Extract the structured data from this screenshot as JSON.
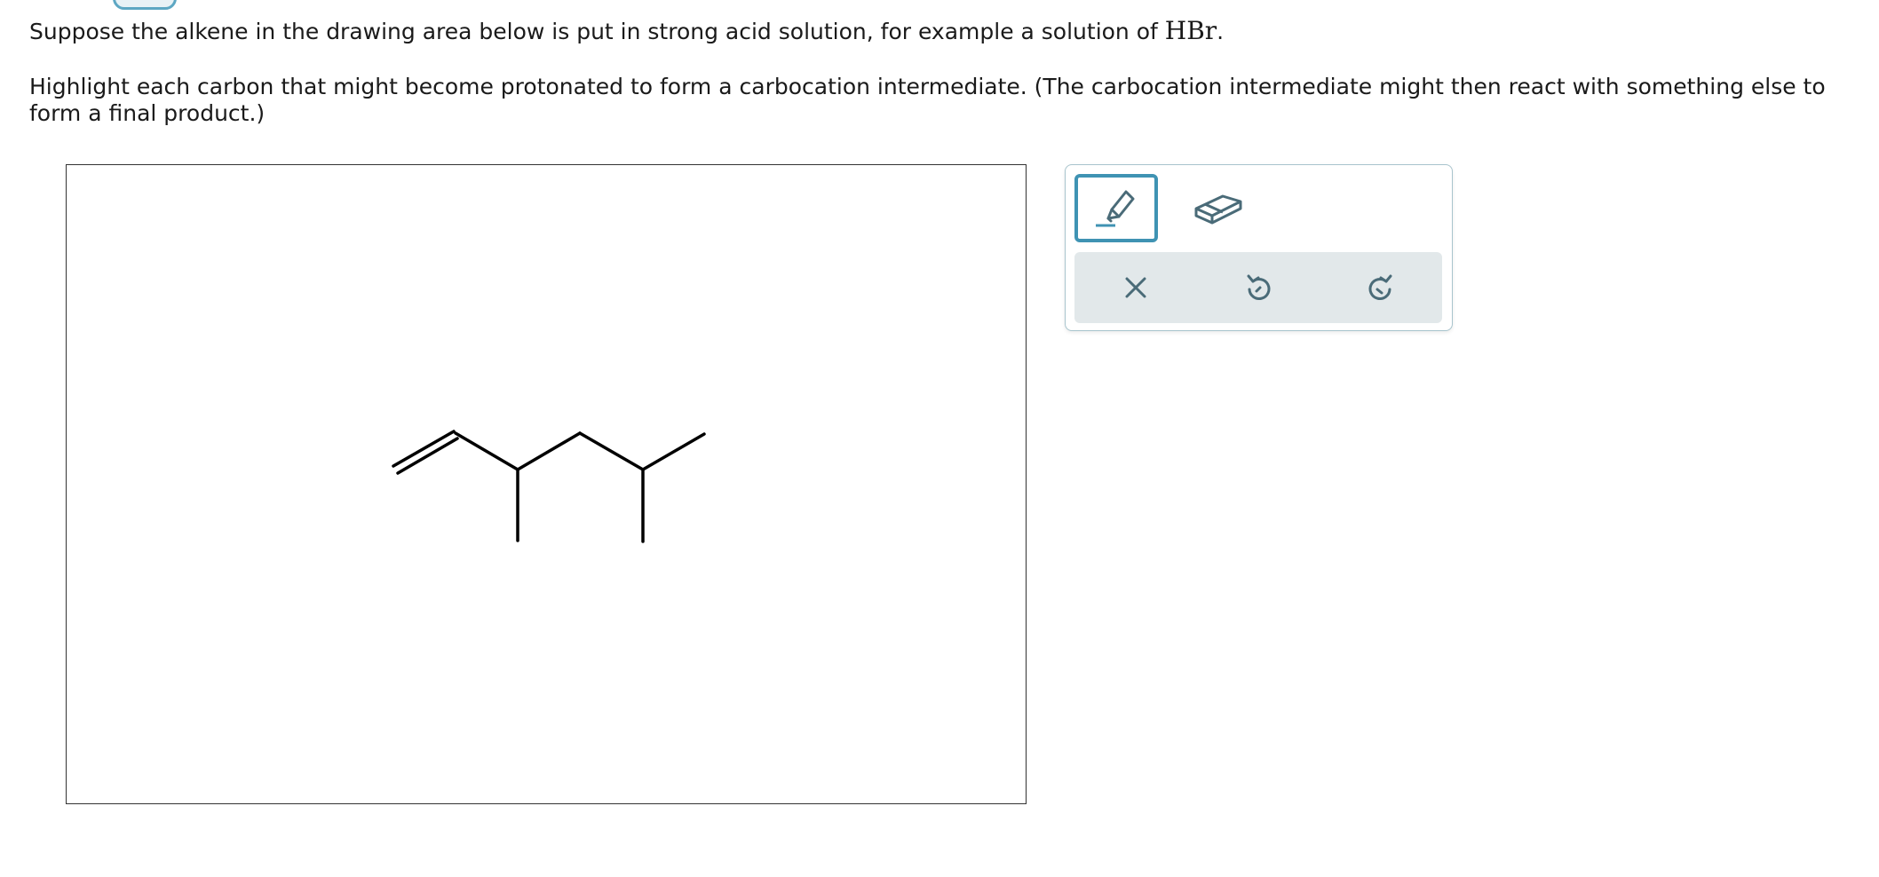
{
  "prompt": {
    "line1_text": "Suppose the alkene in the drawing area below is put in strong acid solution, for example a solution of ",
    "line1_formula": "HBr",
    "line1_end": ".",
    "line2": "Highlight each carbon that might become protonated to form a carbocation intermediate. (The carbocation intermediate might then react with something else to form a final product.)"
  },
  "molecule": {
    "name": "",
    "carbon_count": 8,
    "double_bond": "C1=C2 (terminal)"
  },
  "toolbox": {
    "tools": [
      {
        "name": "highlight",
        "icon": "highlighter-icon",
        "selected": true
      },
      {
        "name": "erase",
        "icon": "eraser-icon",
        "selected": false
      }
    ],
    "actions": [
      {
        "name": "clear",
        "icon": "close-icon"
      },
      {
        "name": "undo",
        "icon": "undo-icon"
      },
      {
        "name": "redo",
        "icon": "redo-icon"
      }
    ]
  },
  "colors": {
    "accent": "#3f93b3",
    "icon": "#4a6b78",
    "action_bar_bg": "#e2e8ea",
    "bond": "#000000"
  }
}
